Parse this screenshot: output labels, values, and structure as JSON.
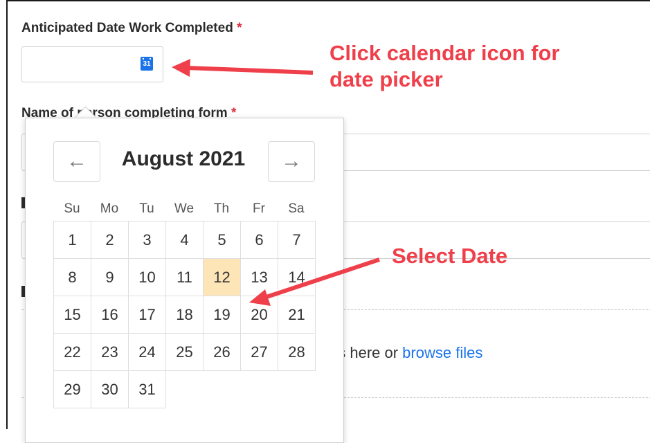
{
  "form": {
    "date_field": {
      "label": "Anticipated Date Work Completed",
      "required_mark": "*",
      "value": "",
      "calendar_icon_text": "31"
    },
    "name_field": {
      "label": "Name of person completing form",
      "required_mark": "*"
    },
    "upload": {
      "text": "es here or ",
      "link": "browse files"
    }
  },
  "annotations": {
    "calendar_hint_line1": "Click calendar icon for",
    "calendar_hint_line2": "date picker",
    "select_hint": "Select Date"
  },
  "datepicker": {
    "month_label": "August 2021",
    "prev_icon": "←",
    "next_icon": "→",
    "weekdays": [
      "Su",
      "Mo",
      "Tu",
      "We",
      "Th",
      "Fr",
      "Sa"
    ],
    "days": [
      "1",
      "2",
      "3",
      "4",
      "5",
      "6",
      "7",
      "8",
      "9",
      "10",
      "11",
      "12",
      "13",
      "14",
      "15",
      "16",
      "17",
      "18",
      "19",
      "20",
      "21",
      "22",
      "23",
      "24",
      "25",
      "26",
      "27",
      "28",
      "29",
      "30",
      "31"
    ],
    "highlighted_day": "12",
    "highlight_color": "#fde5b8"
  },
  "colors": {
    "annotation": "#ef3f4a",
    "link": "#1a73e8",
    "required": "#d9303e"
  }
}
